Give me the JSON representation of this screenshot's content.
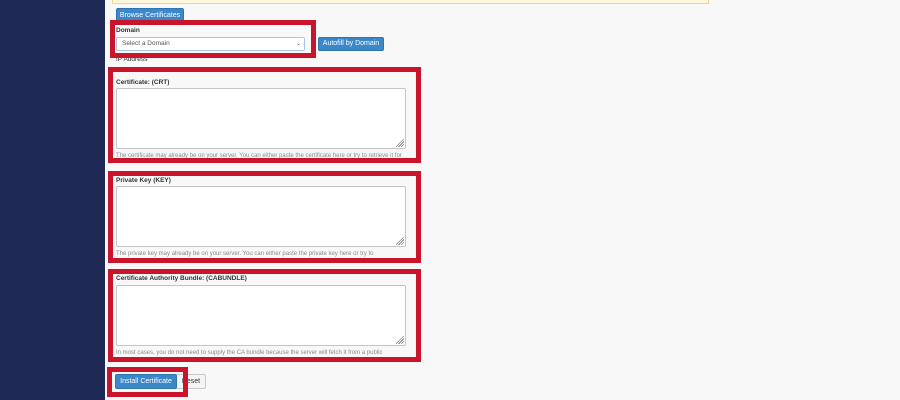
{
  "colors": {
    "sidebar": "#1e2a55",
    "primary_button": "#3a87c9",
    "highlight": "#c9142c",
    "background": "#f8f8f8"
  },
  "toolbar": {
    "browse_label": "Browse Certificates"
  },
  "domain": {
    "label": "Domain",
    "selected": "Select a Domain",
    "chevron_icon": "chevron-down-icon",
    "autofill_label": "Autofill by Domain"
  },
  "ip": {
    "label": "IP Address"
  },
  "certificate": {
    "label": "Certificate: (CRT)",
    "value": "",
    "help": "The certificate may already be on your server. You can either paste the certificate here or try to retrieve it for your domain."
  },
  "private_key": {
    "label": "Private Key (KEY)",
    "value": "",
    "help": "The private key may already be on your server. You can either paste the private key here or try to"
  },
  "cabundle": {
    "label": "Certificate Authority Bundle: (CABUNDLE)",
    "value": "",
    "help": "In most cases, you do not need to supply the CA bundle because the server will fetch it from a public repository during installation."
  },
  "actions": {
    "install_label": "Install Certificate",
    "reset_label": "Reset"
  }
}
